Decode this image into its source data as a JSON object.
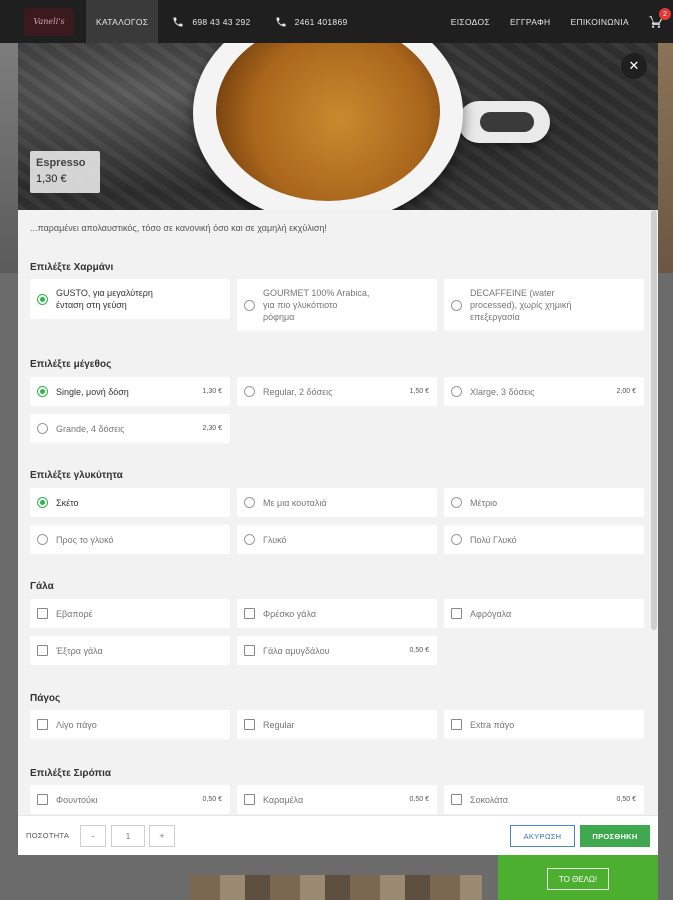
{
  "nav": {
    "logo_text": "Vaneli's",
    "catalog": "ΚΑΤΑΛΟΓΟΣ",
    "phone1": "698 43 43 292",
    "phone2": "2461 401869",
    "login": "ΕΙΣΟΔΟΣ",
    "register": "ΕΓΓΡΑΦΗ",
    "contact": "ΕΠΙΚΟΙΝΩΝΙΑ",
    "cart_count": "2"
  },
  "product": {
    "name": "Espresso",
    "price": "1,30 €",
    "description": "...παραμένει απολαυστικός, τόσο σε κανονική όσο και σε χαμηλή εκχύλιση!"
  },
  "sections": {
    "blend": {
      "title": "Επιλέξτε Χαρμάνι",
      "options": [
        {
          "line1": "GUSTO, για μεγαλύτερη",
          "line2": "ένταση στη γεύση",
          "line3": "",
          "selected": true
        },
        {
          "line1": "GOURMET 100% Arabica,",
          "line2": "για πιο γλυκόπιοτο",
          "line3": "ρόφημα",
          "selected": false
        },
        {
          "line1": "DECAFFEINE (water",
          "line2": "processed), χωρίς χημική",
          "line3": "επεξεργασία",
          "selected": false
        }
      ]
    },
    "size": {
      "title": "Επιλέξτε μέγεθος",
      "options": [
        {
          "label": "Single, μονή δόση",
          "price": "1,30 €",
          "selected": true
        },
        {
          "label": "Regular, 2 δόσεις",
          "price": "1,50 €",
          "selected": false
        },
        {
          "label": "Xlarge, 3 δόσεις",
          "price": "2,00 €",
          "selected": false
        },
        {
          "label": "Grande, 4 δόσεις",
          "price": "2,30 €",
          "selected": false
        }
      ]
    },
    "sweetness": {
      "title": "Επιλέξτε γλυκύτητα",
      "options": [
        {
          "label": "Σκέτο",
          "selected": true
        },
        {
          "label": "Με μια κουταλιά",
          "selected": false
        },
        {
          "label": "Μέτριο",
          "selected": false
        },
        {
          "label": "Προς το γλυκό",
          "selected": false
        },
        {
          "label": "Γλυκό",
          "selected": false
        },
        {
          "label": "Πολύ Γλυκό",
          "selected": false
        }
      ]
    },
    "milk": {
      "title": "Γάλα",
      "options": [
        {
          "label": "Εβαπορέ",
          "price": ""
        },
        {
          "label": "Φρέσκο γάλα",
          "price": ""
        },
        {
          "label": "Αφρόγαλα",
          "price": ""
        },
        {
          "label": "Έξτρα γάλα",
          "price": ""
        },
        {
          "label": "Γάλα αμυγδάλου",
          "price": "0,50 €"
        }
      ]
    },
    "ice": {
      "title": "Πάγος",
      "options": [
        {
          "label": "Λίγο πάγο"
        },
        {
          "label": "Regular"
        },
        {
          "label": "Extra πάγο"
        }
      ]
    },
    "syrups": {
      "title": "Επιλέξτε Σιρόπια",
      "options": [
        {
          "label": "Φουντούκι",
          "price": "0,50 €"
        },
        {
          "label": "Καραμέλα",
          "price": "0,50 €"
        },
        {
          "label": "Σοκολάτα",
          "price": "0,50 €"
        }
      ]
    }
  },
  "footer": {
    "qty_label": "ΠΟΣΟΤΗΤΑ",
    "minus": "-",
    "qty": "1",
    "plus": "+",
    "cancel": "ΑΚΥΡΩΣΗ",
    "add": "ΠΡΟΣΘΗΚΗ"
  },
  "background": {
    "cta": "ΤΟ ΘΕΛΩ!"
  }
}
